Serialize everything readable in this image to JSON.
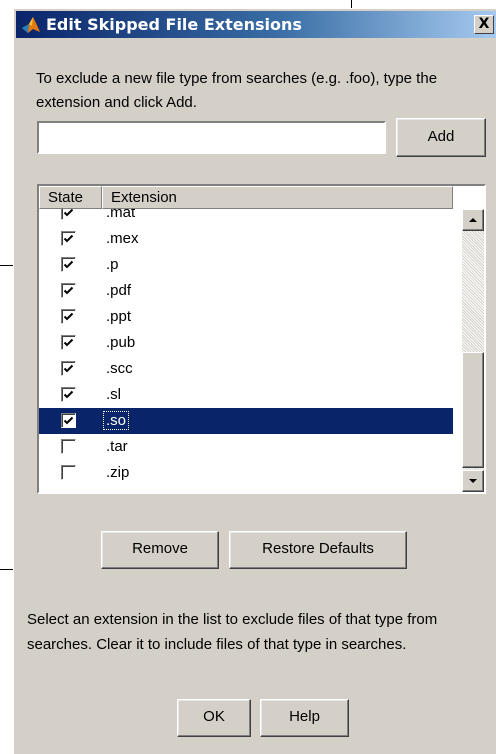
{
  "dialog": {
    "title": "Edit Skipped File Extensions",
    "close_label": "X",
    "instruction": "To exclude a new file type from searches (e.g. .foo), type the extension and click Add.",
    "extension_input": {
      "value": "",
      "placeholder": ""
    },
    "add_label": "Add",
    "list": {
      "columns": [
        "State",
        "Extension"
      ],
      "rows": [
        {
          "extension": ".mat",
          "checked": true,
          "selected": false
        },
        {
          "extension": ".mex",
          "checked": true,
          "selected": false
        },
        {
          "extension": ".p",
          "checked": true,
          "selected": false
        },
        {
          "extension": ".pdf",
          "checked": true,
          "selected": false
        },
        {
          "extension": ".ppt",
          "checked": true,
          "selected": false
        },
        {
          "extension": ".pub",
          "checked": true,
          "selected": false
        },
        {
          "extension": ".scc",
          "checked": true,
          "selected": false
        },
        {
          "extension": ".sl",
          "checked": true,
          "selected": false
        },
        {
          "extension": ".so",
          "checked": true,
          "selected": true
        },
        {
          "extension": ".tar",
          "checked": false,
          "selected": false
        },
        {
          "extension": ".zip",
          "checked": false,
          "selected": false
        }
      ]
    },
    "remove_label": "Remove",
    "restore_label": "Restore Defaults",
    "help_text": "Select an extension in the list to exclude files of that type from searches.  Clear it to include files of that type in searches.",
    "ok_label": "OK",
    "help_label": "Help"
  },
  "colors": {
    "selection": "#0a246a",
    "dialog_bg": "#d4d0c8"
  },
  "icons": [
    "matlab-logo-icon",
    "close-icon",
    "checkmark-icon",
    "scroll-up-arrow-icon",
    "scroll-down-arrow-icon"
  ]
}
